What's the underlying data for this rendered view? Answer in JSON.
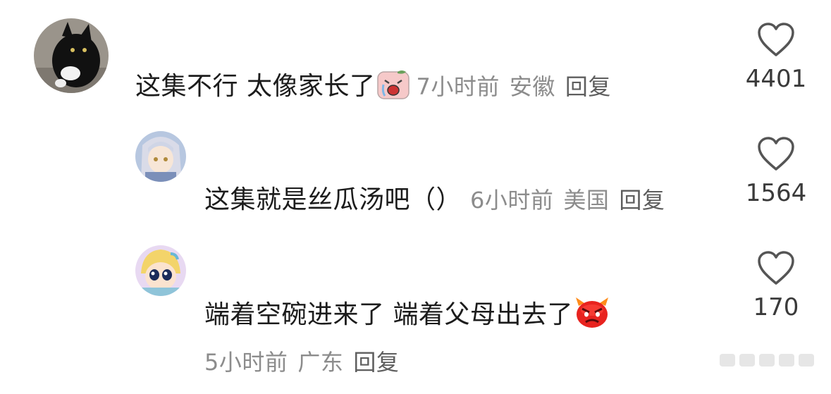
{
  "comments": [
    {
      "text": "这集不行 太像家长了",
      "time": "7小时前",
      "location": "安徽",
      "reply": "回复",
      "likes": "4401",
      "emoji": "crying-peach-emoji"
    },
    {
      "text": "这集就是丝瓜汤吧（）",
      "time": "6小时前",
      "location": "美国",
      "reply": "回复",
      "likes": "1564"
    },
    {
      "text": "端着空碗进来了 端着父母出去了",
      "time": "5小时前",
      "location": "广东",
      "reply": "回复",
      "likes": "170",
      "emoji": "angry-red-face-emoji"
    }
  ],
  "colors": {
    "text": "#1c1c1c",
    "meta": "#8c8c8c",
    "heart": "#555555"
  }
}
